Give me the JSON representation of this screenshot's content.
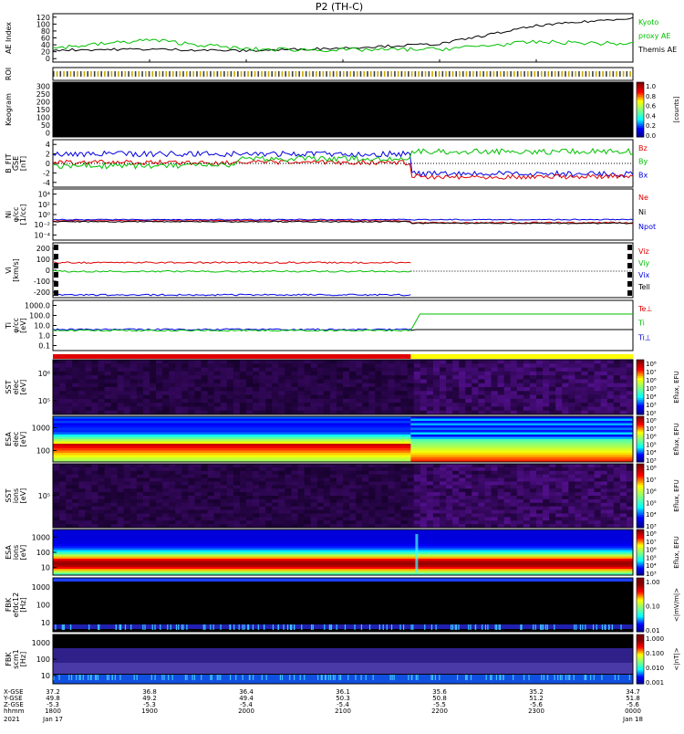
{
  "title": "P2 (TH-C)",
  "panels": [
    {
      "key": "ae",
      "ylabel": [
        "AE Index"
      ],
      "ticks": [
        "120",
        "100",
        "80",
        "60",
        "40",
        "20",
        "0"
      ],
      "right": [
        {
          "text": "Kyoto",
          "color": "#00c000"
        },
        {
          "text": "proxy AE",
          "color": "#00c000"
        },
        {
          "text": "Themis AE",
          "color": "#000000"
        }
      ]
    },
    {
      "key": "roi",
      "ylabel": [
        "ROI"
      ],
      "ticks": [],
      "right": []
    },
    {
      "key": "keogram",
      "ylabel": [
        "Keogram"
      ],
      "ticks": [
        "300",
        "250",
        "200",
        "150",
        "100",
        "50",
        "0"
      ],
      "right": [],
      "colorbar": {
        "ticks": [
          "1.0",
          "0.8",
          "0.6",
          "0.4",
          "0.2",
          "0.0"
        ],
        "label": "[counts]"
      }
    },
    {
      "key": "bfield",
      "ylabel": [
        "B_FIT",
        "GSE",
        "[nT]"
      ],
      "ticks": [
        "4",
        "2",
        "0",
        "-2",
        "-4"
      ],
      "right": [
        {
          "text": "Bz",
          "color": "#e00000"
        },
        {
          "text": "By",
          "color": "#00c000"
        },
        {
          "text": "Bx",
          "color": "#0000e0"
        }
      ]
    },
    {
      "key": "density",
      "ylabel": [
        "Ni",
        "φ/cc",
        "[1/cc]"
      ],
      "ticks": [
        "10⁴",
        "10²",
        "10⁰",
        "10⁻²",
        "10⁻⁴"
      ],
      "right": [
        {
          "text": "Ne",
          "color": "#e00000"
        },
        {
          "text": "Ni",
          "color": "#000000"
        },
        {
          "text": "Npot",
          "color": "#0000e0"
        }
      ]
    },
    {
      "key": "velocity",
      "ylabel": [
        "Vi",
        "[km/s]"
      ],
      "ticks": [
        "200",
        "100",
        "0",
        "-100",
        "-200"
      ],
      "right": [
        {
          "text": "Viz",
          "color": "#e00000"
        },
        {
          "text": "Viy",
          "color": "#00c000"
        },
        {
          "text": "Vix",
          "color": "#0000e0"
        },
        {
          "text": "Tell",
          "color": "#000000"
        }
      ]
    },
    {
      "key": "temperature",
      "ylabel": [
        "Ti",
        "φ/cc",
        "[eV]"
      ],
      "ticks": [
        "1000.0",
        "100.0",
        "10.0",
        "1.0",
        "0.1"
      ],
      "right": [
        {
          "text": "Te⊥",
          "color": "#e00000"
        },
        {
          "text": "Ti",
          "color": "#00c000"
        },
        {
          "text": "Ti⊥",
          "color": "#0000e0"
        }
      ]
    },
    {
      "key": "sst_e",
      "ylabel": [
        "SST",
        "elec",
        "[eV]"
      ],
      "ticks": [
        "10⁶",
        "10⁵"
      ],
      "right": [],
      "colorbar": {
        "ticks": [
          "10⁸",
          "10⁷",
          "10⁶",
          "10⁵",
          "10⁴",
          "10³",
          "10²"
        ],
        "label": "Eflux, EFU"
      }
    },
    {
      "key": "esa_e",
      "ylabel": [
        "ESA",
        "elec",
        "[eV]"
      ],
      "ticks": [
        "1000",
        "100"
      ],
      "right": [],
      "colorbar": {
        "ticks": [
          "10⁸",
          "10⁷",
          "10⁶",
          "10⁵",
          "10⁴",
          "10³"
        ],
        "label": "Eflux, EFU"
      }
    },
    {
      "key": "sst_i",
      "ylabel": [
        "SST",
        "ions",
        "[eV]"
      ],
      "ticks": [
        "10⁵"
      ],
      "right": [],
      "colorbar": {
        "ticks": [
          "10⁸",
          "10⁷",
          "10⁶",
          "10⁵",
          "10⁴",
          "10³"
        ],
        "label": "Eflux, EFU"
      }
    },
    {
      "key": "esa_i",
      "ylabel": [
        "ESA",
        "ions",
        "[eV]"
      ],
      "ticks": [
        "1000",
        "100",
        "10"
      ],
      "right": [],
      "colorbar": {
        "ticks": [
          "10⁸",
          "10⁷",
          "10⁶",
          "10⁵",
          "10⁴",
          "10³"
        ],
        "label": "Eflux, EFU"
      }
    },
    {
      "key": "fbk_e",
      "ylabel": [
        "FBK",
        "efdc12",
        "[Hz]"
      ],
      "ticks": [
        "1000",
        "100",
        "10"
      ],
      "right": [],
      "colorbar": {
        "ticks": [
          "1.00",
          "0.10",
          "0.01"
        ],
        "label": "<|mV/m|>"
      }
    },
    {
      "key": "fbk_b",
      "ylabel": [
        "FBK",
        "scm1",
        "[Hz]"
      ],
      "ticks": [
        "1000",
        "100",
        "10"
      ],
      "right": [],
      "colorbar": {
        "ticks": [
          "1.000",
          "0.100",
          "0.010",
          "0.001"
        ],
        "label": "<|nT|>"
      }
    }
  ],
  "footer": {
    "labels": [
      "X-GSE",
      "Y-GSE",
      "Z-GSE",
      "hhmm",
      "2021"
    ],
    "columns": [
      [
        "37.2",
        "49.8",
        "-5.3",
        "1800",
        "Jan 17"
      ],
      [
        "36.8",
        "49.2",
        "-5.3",
        "1900",
        ""
      ],
      [
        "36.4",
        "49.4",
        "-5.4",
        "2000",
        ""
      ],
      [
        "36.1",
        "50.3",
        "-5.4",
        "2100",
        ""
      ],
      [
        "35.6",
        "50.8",
        "-5.5",
        "2200",
        ""
      ],
      [
        "35.2",
        "51.2",
        "-5.6",
        "2300",
        ""
      ],
      [
        "34.7",
        "51.8",
        "-5.6",
        "0000",
        "Jan 18"
      ]
    ]
  },
  "chart_data": {
    "type": "line",
    "title": "P2 (TH-C)",
    "x": [
      "1800",
      "1900",
      "2000",
      "2100",
      "2200",
      "2300",
      "0000"
    ],
    "xlabel": "hhmm",
    "series": [
      {
        "name": "Themis AE",
        "color": "#000000",
        "values": [
          30,
          32,
          28,
          35,
          45,
          90,
          110
        ]
      },
      {
        "name": "Kyoto proxy AE",
        "color": "#00c000",
        "values": [
          35,
          55,
          32,
          30,
          32,
          50,
          45
        ]
      }
    ],
    "ylabel": "AE Index",
    "ylim": [
      0,
      120
    ]
  }
}
